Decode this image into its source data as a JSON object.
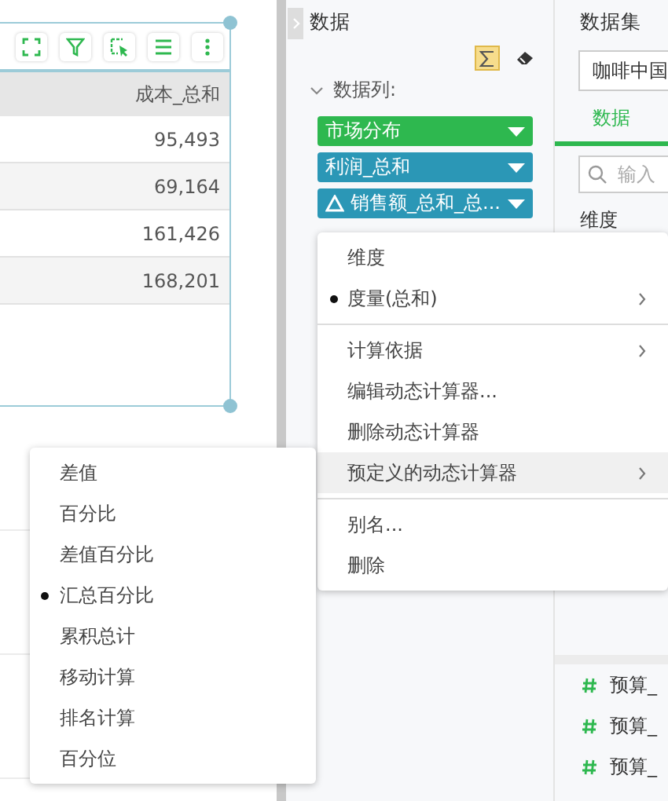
{
  "table": {
    "columns": [
      "成本_总和"
    ],
    "rows": [
      [
        "95,493"
      ],
      [
        "69,164"
      ],
      [
        "161,426"
      ],
      [
        "168,201"
      ]
    ]
  },
  "data_panel": {
    "title": "数据",
    "summary_on": true,
    "section": {
      "label": "数据列:",
      "expanded": true
    },
    "fields": [
      {
        "label": "市场分布",
        "color": "#2eb84f",
        "dynamic": false
      },
      {
        "label": "利润_总和",
        "color": "#2b97b6",
        "dynamic": false
      },
      {
        "label": "销售额_总和_总...",
        "color": "#2b97b6",
        "dynamic": true
      }
    ]
  },
  "dataset_panel": {
    "title": "数据集",
    "dataset": "咖啡中国",
    "tabs": [
      {
        "label": "数据",
        "selected": true
      }
    ],
    "search": {
      "placeholder": "输入"
    },
    "heading": "维度",
    "measures": [
      {
        "label": "预算_"
      },
      {
        "label": "预算_"
      },
      {
        "label": "预算_"
      }
    ]
  },
  "context_menu": {
    "items": [
      {
        "kind": "item",
        "label": "维度",
        "bullet": false,
        "submenu": false,
        "highlighted": false
      },
      {
        "kind": "item",
        "label": "度量(总和)",
        "bullet": true,
        "submenu": true,
        "highlighted": false
      },
      {
        "kind": "separator"
      },
      {
        "kind": "item",
        "label": "计算依据",
        "bullet": false,
        "submenu": true,
        "highlighted": false
      },
      {
        "kind": "item",
        "label": "编辑动态计算器...",
        "bullet": false,
        "submenu": false,
        "highlighted": false
      },
      {
        "kind": "item",
        "label": "删除动态计算器",
        "bullet": false,
        "submenu": false,
        "highlighted": false
      },
      {
        "kind": "item",
        "label": "预定义的动态计算器",
        "bullet": false,
        "submenu": true,
        "highlighted": true
      },
      {
        "kind": "separator"
      },
      {
        "kind": "item",
        "label": "别名...",
        "bullet": false,
        "submenu": false,
        "highlighted": false
      },
      {
        "kind": "item",
        "label": "删除",
        "bullet": false,
        "submenu": false,
        "highlighted": false
      }
    ]
  },
  "submenu": {
    "items": [
      {
        "label": "差值",
        "selected": false
      },
      {
        "label": "百分比",
        "selected": false
      },
      {
        "label": "差值百分比",
        "selected": false
      },
      {
        "label": "汇总百分比",
        "selected": true
      },
      {
        "label": "累积总计",
        "selected": false
      },
      {
        "label": "移动计算",
        "selected": false
      },
      {
        "label": "排名计算",
        "selected": false
      },
      {
        "label": "百分位",
        "selected": false
      }
    ]
  }
}
